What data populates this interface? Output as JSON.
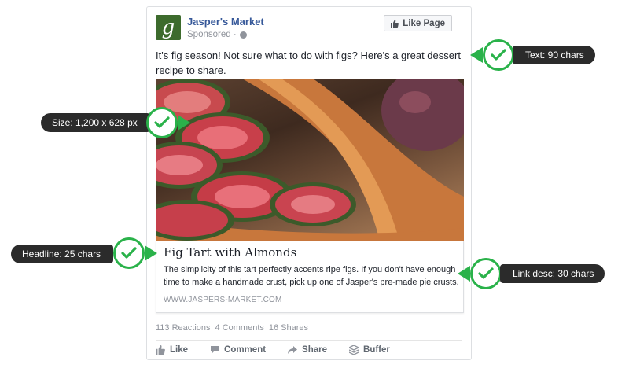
{
  "post": {
    "avatar_letter": "g",
    "page_name": "Jasper's Market",
    "sponsored": "Sponsored ·",
    "like_page_label": "Like Page",
    "text": "It's fig season! Not sure what to do with figs? Here's a great dessert recipe to share.",
    "link": {
      "headline": "Fig Tart with Almonds",
      "description": "The simplicity of this tart perfectly accents ripe figs. If you don't have enough time to make a handmade crust, pick up one of Jasper's pre-made pie crusts.",
      "url": "WWW.JASPERS-MARKET.COM"
    },
    "stats": {
      "reactions": "113 Reactions",
      "comments": "4 Comments",
      "shares": "16 Shares"
    },
    "actions": [
      "Like",
      "Comment",
      "Share",
      "Buffer"
    ]
  },
  "callouts": {
    "text": "Text: 90 chars",
    "size": "Size: 1,200 x 628 px",
    "headline": "Headline: 25 chars",
    "link_desc": "Link desc: 30 chars"
  },
  "colors": {
    "accent_green": "#2ab24a",
    "facebook_blue": "#365899",
    "callout_bg": "#2b2b2b"
  }
}
